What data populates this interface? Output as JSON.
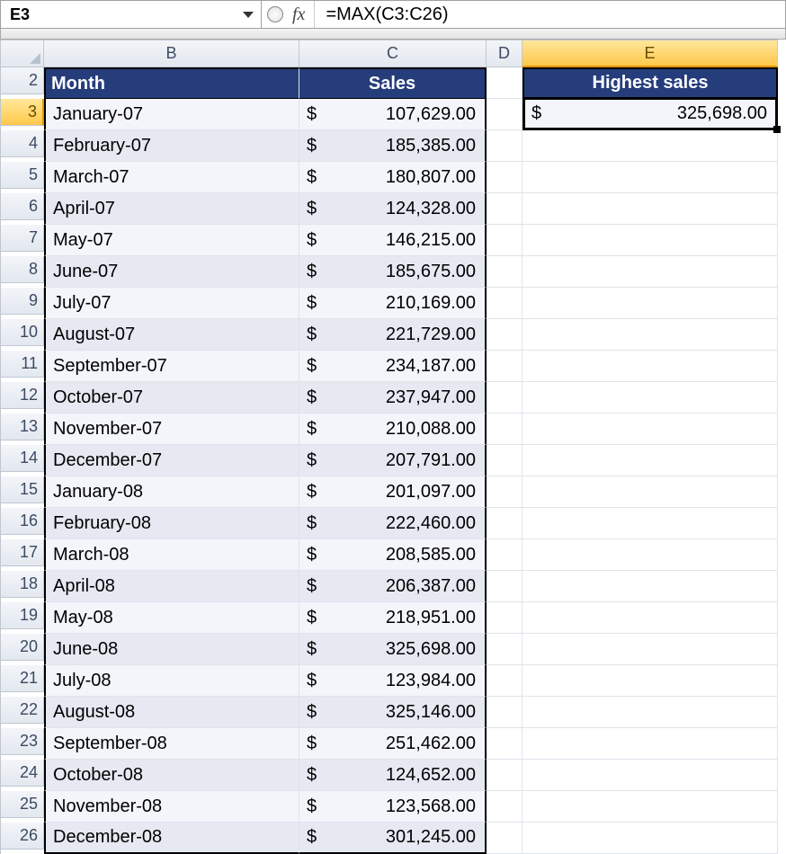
{
  "formula_bar": {
    "cell_ref": "E3",
    "fx_label": "fx",
    "formula": "=MAX(C3:C26)"
  },
  "columns": [
    "B",
    "C",
    "D",
    "E"
  ],
  "selected_column": "E",
  "row_start": 2,
  "selected_row": 3,
  "headers": {
    "month": "Month",
    "sales": "Sales",
    "highest": "Highest sales"
  },
  "currency": "$",
  "rows": [
    {
      "row": 3,
      "month": "January-07",
      "sales": "107,629.00"
    },
    {
      "row": 4,
      "month": "February-07",
      "sales": "185,385.00"
    },
    {
      "row": 5,
      "month": "March-07",
      "sales": "180,807.00"
    },
    {
      "row": 6,
      "month": "April-07",
      "sales": "124,328.00"
    },
    {
      "row": 7,
      "month": "May-07",
      "sales": "146,215.00"
    },
    {
      "row": 8,
      "month": "June-07",
      "sales": "185,675.00"
    },
    {
      "row": 9,
      "month": "July-07",
      "sales": "210,169.00"
    },
    {
      "row": 10,
      "month": "August-07",
      "sales": "221,729.00"
    },
    {
      "row": 11,
      "month": "September-07",
      "sales": "234,187.00"
    },
    {
      "row": 12,
      "month": "October-07",
      "sales": "237,947.00"
    },
    {
      "row": 13,
      "month": "November-07",
      "sales": "210,088.00"
    },
    {
      "row": 14,
      "month": "December-07",
      "sales": "207,791.00"
    },
    {
      "row": 15,
      "month": "January-08",
      "sales": "201,097.00"
    },
    {
      "row": 16,
      "month": "February-08",
      "sales": "222,460.00"
    },
    {
      "row": 17,
      "month": "March-08",
      "sales": "208,585.00"
    },
    {
      "row": 18,
      "month": "April-08",
      "sales": "206,387.00"
    },
    {
      "row": 19,
      "month": "May-08",
      "sales": "218,951.00"
    },
    {
      "row": 20,
      "month": "June-08",
      "sales": "325,698.00"
    },
    {
      "row": 21,
      "month": "July-08",
      "sales": "123,984.00"
    },
    {
      "row": 22,
      "month": "August-08",
      "sales": "325,146.00"
    },
    {
      "row": 23,
      "month": "September-08",
      "sales": "251,462.00"
    },
    {
      "row": 24,
      "month": "October-08",
      "sales": "124,652.00"
    },
    {
      "row": 25,
      "month": "November-08",
      "sales": "123,568.00"
    },
    {
      "row": 26,
      "month": "December-08",
      "sales": "301,245.00"
    }
  ],
  "highest_sales": "325,698.00"
}
